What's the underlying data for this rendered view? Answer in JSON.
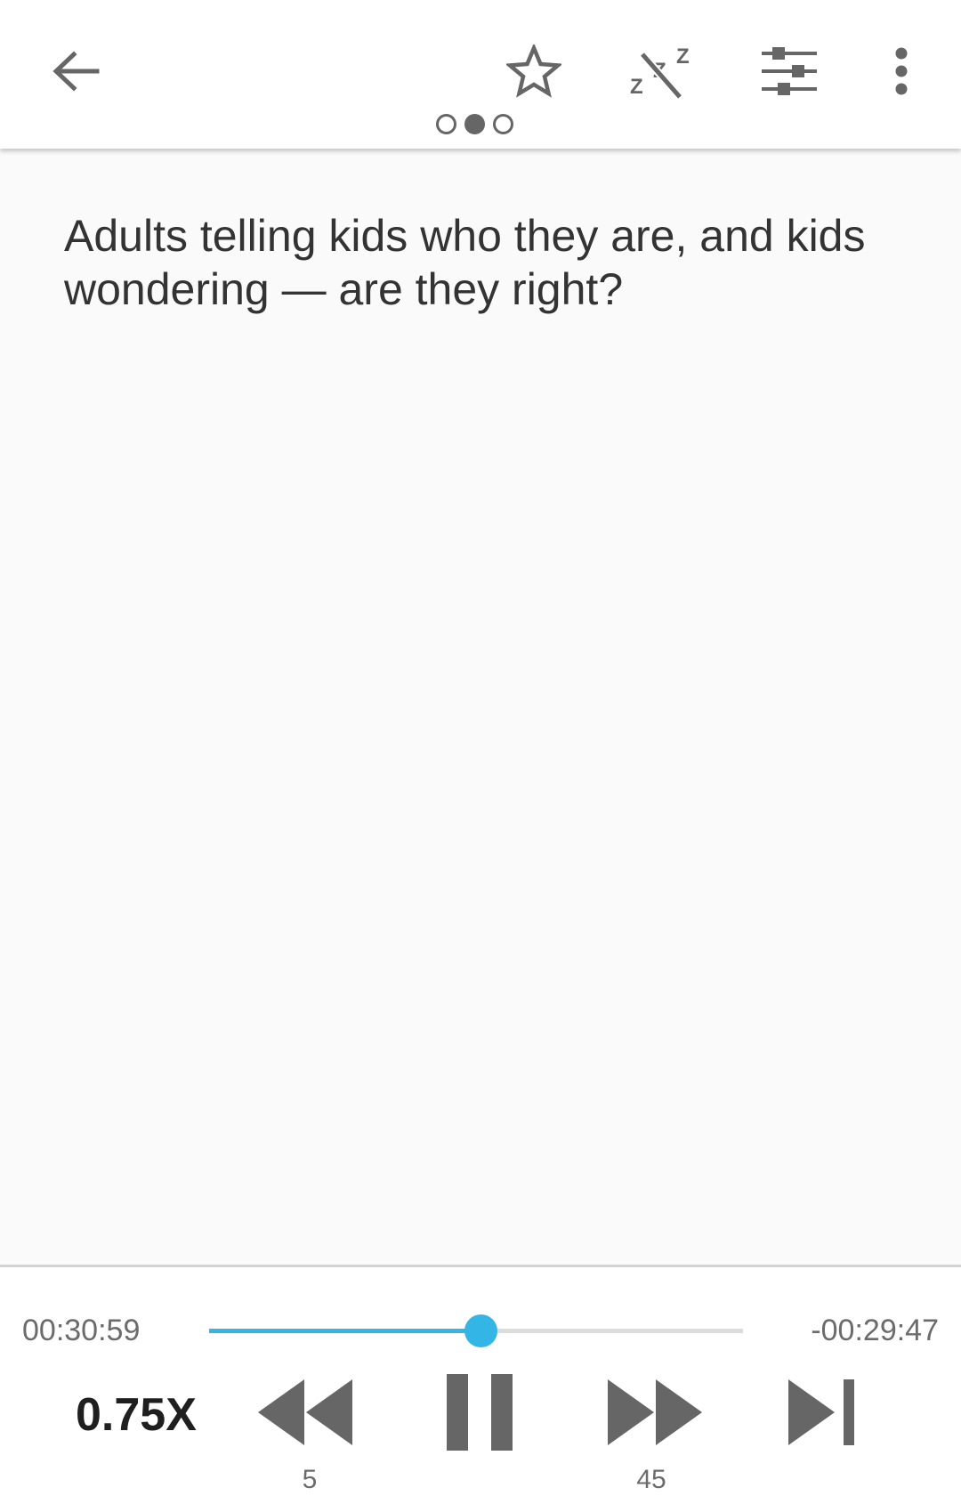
{
  "toolbar": {
    "back_icon": "arrow-left-icon",
    "favorite_icon": "star-outline-icon",
    "sleep_timer_icon": "sleep-off-icon",
    "equalizer_icon": "sliders-icon",
    "more_icon": "more-vert-icon",
    "page_indicator": {
      "count": 3,
      "active_index": 1
    }
  },
  "content": {
    "text": "Adults telling kids who they are, and kids wondering — are they right?"
  },
  "player": {
    "elapsed": "00:30:59",
    "remaining": "-00:29:47",
    "progress": 0.509,
    "speed": "0.75X",
    "rewind_seconds": "5",
    "forward_seconds": "45",
    "rewind_icon": "rewind-icon",
    "pause_icon": "pause-icon",
    "forward_icon": "fast-forward-icon",
    "skip_next_icon": "skip-next-icon",
    "accent_color": "#33b5e5",
    "icon_color": "#666666"
  }
}
